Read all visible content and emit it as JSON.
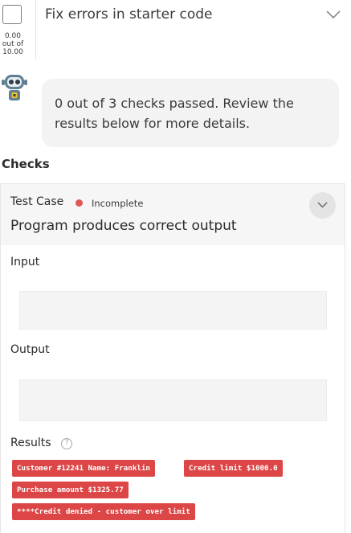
{
  "header": {
    "title": "Fix errors in starter code",
    "score_line1": "0.00",
    "score_line2": "out of",
    "score_line3": "10.00"
  },
  "message": {
    "text": "0 out of 3 checks passed. Review the results below for more details."
  },
  "checks": {
    "title": "Checks",
    "test_case": {
      "label": "Test Case",
      "status": "Incomplete",
      "status_color": "#e0585b",
      "name": "Program produces correct output",
      "input_label": "Input",
      "output_label": "Output",
      "results_label": "Results",
      "results": [
        "Customer #12241 Name: Franklin",
        "Credit limit $1000.0",
        "Purchase amount $1325.77",
        "****Credit denied - customer over limit"
      ]
    }
  },
  "colors": {
    "chip_bg": "#dc4646",
    "bubble_bg": "#f3f3f3",
    "card_head_bg": "#f6f6f6"
  }
}
